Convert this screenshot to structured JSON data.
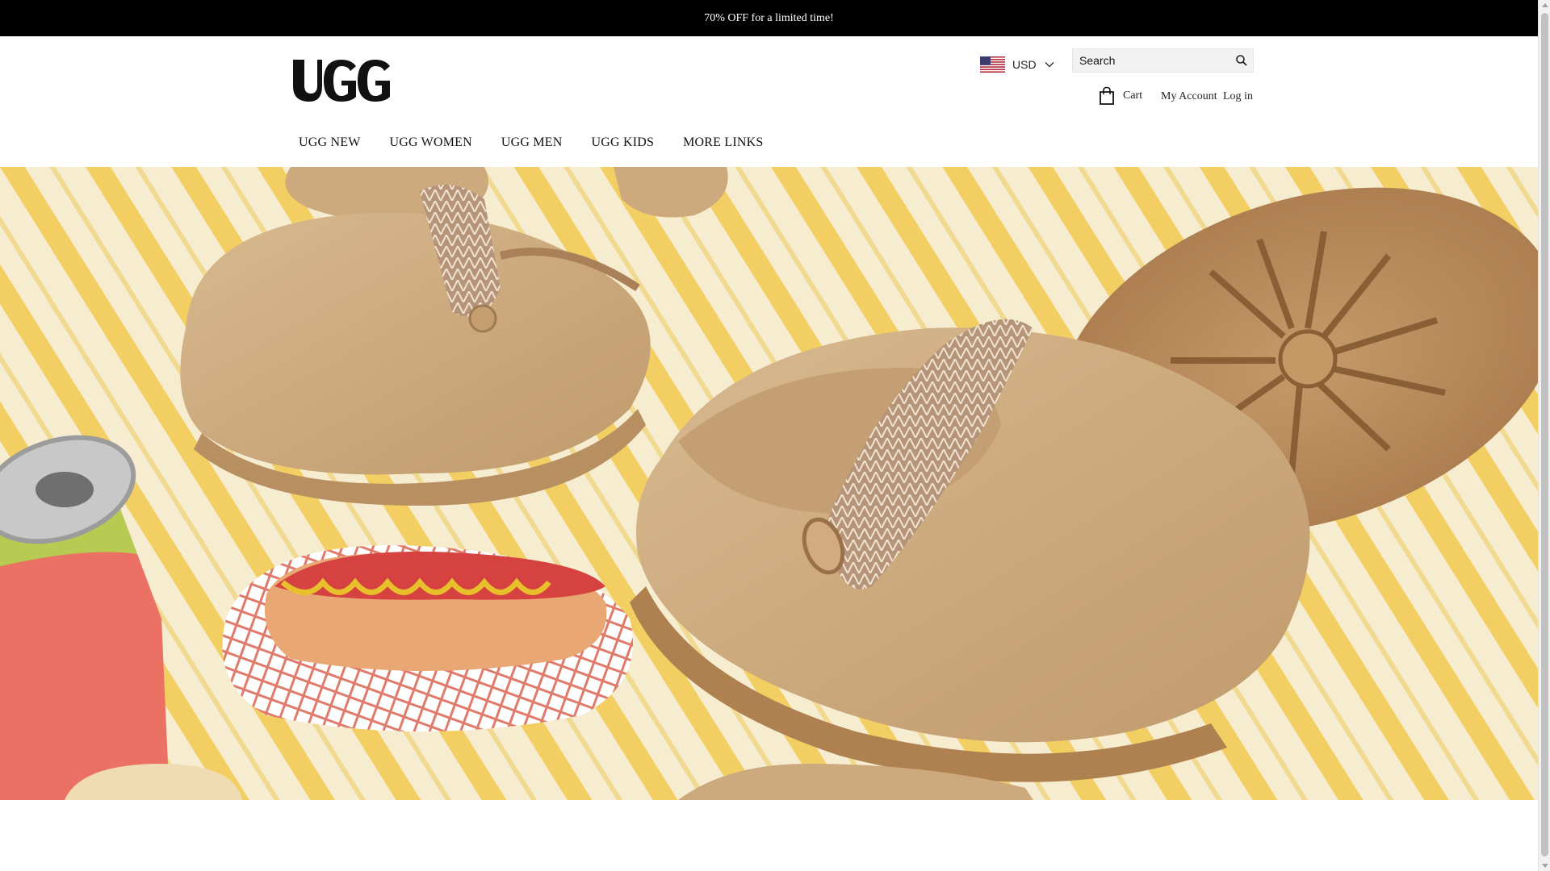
{
  "announcement": {
    "text": "70% OFF for a limited time!"
  },
  "header": {
    "logo_text": "UGG",
    "currency": {
      "code": "USD"
    },
    "search": {
      "placeholder": "Search"
    },
    "cart_label": "Cart",
    "account_label": "My Account",
    "login_label": "Log in"
  },
  "nav": {
    "items": [
      {
        "label": "UGG NEW"
      },
      {
        "label": "UGG WOMEN"
      },
      {
        "label": "UGG MEN"
      },
      {
        "label": "UGG KIDS"
      },
      {
        "label": "MORE LINKS"
      }
    ]
  },
  "colors": {
    "announcement_bg": "#000000",
    "hero_stripe_yellow": "#f3cf63",
    "hero_stripe_cream": "#f6ecd0",
    "suede": "#c9a77c"
  },
  "icons": {
    "flag": "us-flag-icon",
    "currency_chevron": "chevron-down-icon",
    "search": "search-icon",
    "cart": "shopping-bag-icon"
  }
}
